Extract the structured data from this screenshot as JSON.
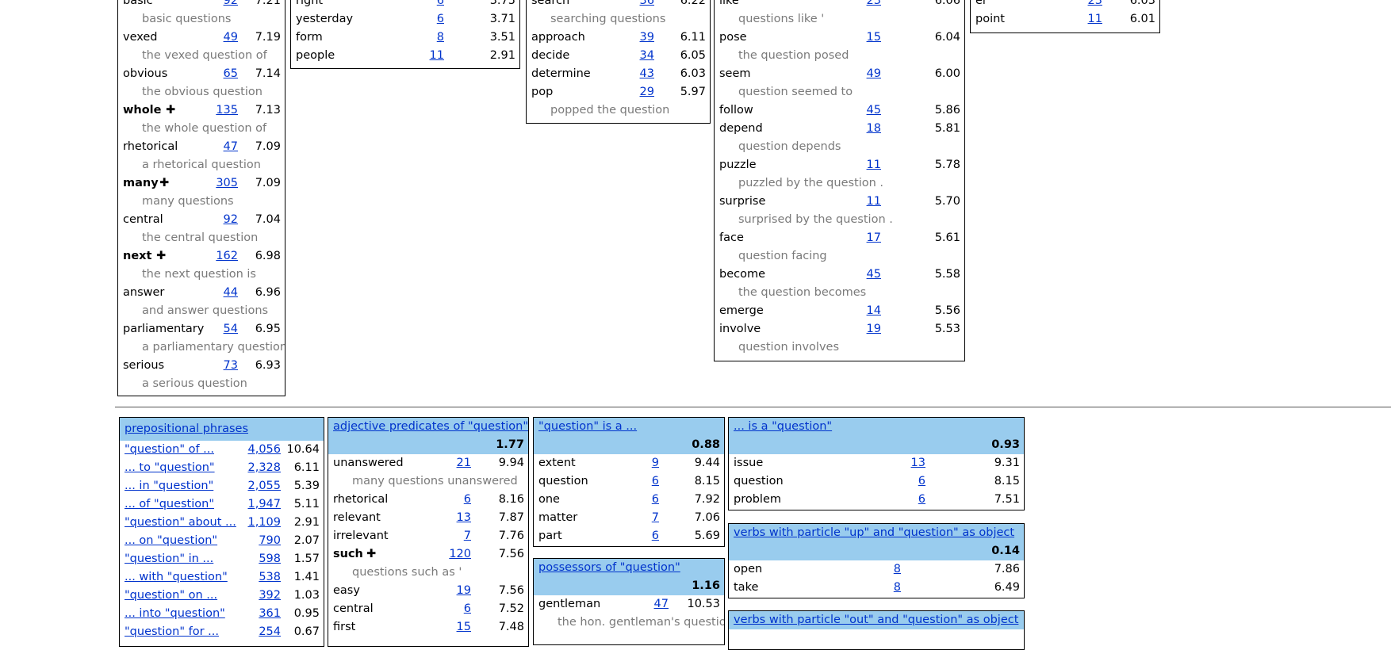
{
  "modifiers": {
    "rows": [
      {
        "word": "basic",
        "count": "92",
        "score": "7.21",
        "example": "basic questions"
      },
      {
        "word": "vexed",
        "count": "49",
        "score": "7.19",
        "example": "the vexed question of"
      },
      {
        "word": "obvious",
        "count": "65",
        "score": "7.14",
        "example": "the obvious question"
      },
      {
        "word": "whole",
        "bold": true,
        "count": "135",
        "score": "7.13",
        "example": "the whole question of"
      },
      {
        "word": "rhetorical",
        "count": "47",
        "score": "7.09",
        "example": "a rhetorical question"
      },
      {
        "word": "many",
        "bold": true,
        "count": "305",
        "score": "7.09",
        "example": "many questions"
      },
      {
        "word": "central",
        "count": "92",
        "score": "7.04",
        "example": "the central question"
      },
      {
        "word": "next",
        "bold": true,
        "count": "162",
        "score": "6.98",
        "example": "the next question is"
      },
      {
        "word": "answer",
        "count": "44",
        "score": "6.96",
        "example": "and answer questions"
      },
      {
        "word": "parliamentary",
        "count": "54",
        "score": "6.95",
        "example": "a parliamentary question"
      },
      {
        "word": "serious",
        "count": "73",
        "score": "6.93",
        "example": "a serious question"
      }
    ]
  },
  "box2": {
    "rows": [
      {
        "word": "right",
        "count": "6",
        "score": "3.75"
      },
      {
        "word": "yesterday",
        "count": "6",
        "score": "3.71"
      },
      {
        "word": "form",
        "count": "8",
        "score": "3.51"
      },
      {
        "word": "people",
        "count": "11",
        "score": "2.91"
      }
    ]
  },
  "box3": {
    "rows": [
      {
        "word": "search",
        "count": "36",
        "score": "6.22",
        "example": "searching questions"
      },
      {
        "word": "approach",
        "count": "39",
        "score": "6.11"
      },
      {
        "word": "decide",
        "count": "34",
        "score": "6.05"
      },
      {
        "word": "determine",
        "count": "43",
        "score": "6.03"
      },
      {
        "word": "pop",
        "count": "29",
        "score": "5.97",
        "example": "popped the question"
      }
    ]
  },
  "box4": {
    "rows": [
      {
        "word": "like",
        "count": "23",
        "score": "6.06",
        "example": "questions like '"
      },
      {
        "word": "pose",
        "count": "15",
        "score": "6.04",
        "example": "the question posed"
      },
      {
        "word": "seem",
        "count": "49",
        "score": "6.00",
        "example": "question seemed to"
      },
      {
        "word": "follow",
        "count": "45",
        "score": "5.86"
      },
      {
        "word": "depend",
        "count": "18",
        "score": "5.81",
        "example": "question depends"
      },
      {
        "word": "puzzle",
        "count": "11",
        "score": "5.78",
        "example": "puzzled by the question ."
      },
      {
        "word": "surprise",
        "count": "11",
        "score": "5.70",
        "example": "surprised by the question ."
      },
      {
        "word": "face",
        "count": "17",
        "score": "5.61",
        "example": "question facing"
      },
      {
        "word": "become",
        "count": "45",
        "score": "5.58",
        "example": "the question becomes"
      },
      {
        "word": "emerge",
        "count": "14",
        "score": "5.56"
      },
      {
        "word": "involve",
        "count": "19",
        "score": "5.53",
        "example": "question involves"
      }
    ]
  },
  "box5": {
    "rows": [
      {
        "word": "er",
        "count": "23",
        "score": "6.03"
      },
      {
        "word": "point",
        "count": "11",
        "score": "6.01"
      }
    ]
  },
  "prep": {
    "title": "prepositional phrases",
    "rows": [
      {
        "phrase": "\"question\" of ...",
        "count": "4,056",
        "score": "10.64"
      },
      {
        "phrase": "... to \"question\"",
        "count": "2,328",
        "score": "6.11"
      },
      {
        "phrase": "... in \"question\"",
        "count": "2,055",
        "score": "5.39"
      },
      {
        "phrase": "... of \"question\"",
        "count": "1,947",
        "score": "5.11"
      },
      {
        "phrase": "\"question\" about ...",
        "count": "1,109",
        "score": "2.91"
      },
      {
        "phrase": "... on \"question\"",
        "count": "790",
        "score": "2.07"
      },
      {
        "phrase": "\"question\" in ...",
        "count": "598",
        "score": "1.57"
      },
      {
        "phrase": "... with \"question\"",
        "count": "538",
        "score": "1.41"
      },
      {
        "phrase": "\"question\" on ...",
        "count": "392",
        "score": "1.03"
      },
      {
        "phrase": "... into \"question\"",
        "count": "361",
        "score": "0.95"
      },
      {
        "phrase": "\"question\" for ...",
        "count": "254",
        "score": "0.67"
      }
    ]
  },
  "adjpred": {
    "title": "adjective predicates of \"question\"",
    "score": "1.77",
    "rows": [
      {
        "word": "unanswered",
        "count": "21",
        "score": "9.94",
        "example": "many questions unanswered"
      },
      {
        "word": "rhetorical",
        "count": "6",
        "score": "8.16"
      },
      {
        "word": "relevant",
        "count": "13",
        "score": "7.87"
      },
      {
        "word": "irrelevant",
        "count": "7",
        "score": "7.76"
      },
      {
        "word": "such",
        "bold": true,
        "count": "120",
        "score": "7.56",
        "example": "questions such as '"
      },
      {
        "word": "easy",
        "count": "19",
        "score": "7.56"
      },
      {
        "word": "central",
        "count": "6",
        "score": "7.52"
      },
      {
        "word": "first",
        "count": "15",
        "score": "7.48"
      }
    ]
  },
  "isa": {
    "title": "\"question\" is a ...",
    "score": "0.88",
    "rows": [
      {
        "word": "extent",
        "count": "9",
        "score": "9.44"
      },
      {
        "word": "question",
        "count": "6",
        "score": "8.15"
      },
      {
        "word": "one",
        "count": "6",
        "score": "7.92"
      },
      {
        "word": "matter",
        "count": "7",
        "score": "7.06"
      },
      {
        "word": "part",
        "count": "6",
        "score": "5.69"
      }
    ]
  },
  "possessors": {
    "title": "possessors of \"question\"",
    "score": "1.16",
    "rows": [
      {
        "word": "gentleman",
        "count": "47",
        "score": "10.53",
        "example": "the hon. gentleman's question"
      }
    ]
  },
  "isaq": {
    "title": "... is a \"question\"",
    "score": "0.93",
    "rows": [
      {
        "word": "issue",
        "count": "13",
        "score": "9.31"
      },
      {
        "word": "question",
        "count": "6",
        "score": "8.15"
      },
      {
        "word": "problem",
        "count": "6",
        "score": "7.51"
      }
    ]
  },
  "particle_up": {
    "title": "verbs with particle \"up\" and \"question\" as object",
    "score": "0.14",
    "rows": [
      {
        "word": "open",
        "count": "8",
        "score": "7.86"
      },
      {
        "word": "take",
        "count": "8",
        "score": "6.49"
      }
    ]
  },
  "particle_out": {
    "title": "verbs with particle \"out\" and \"question\" as object"
  }
}
